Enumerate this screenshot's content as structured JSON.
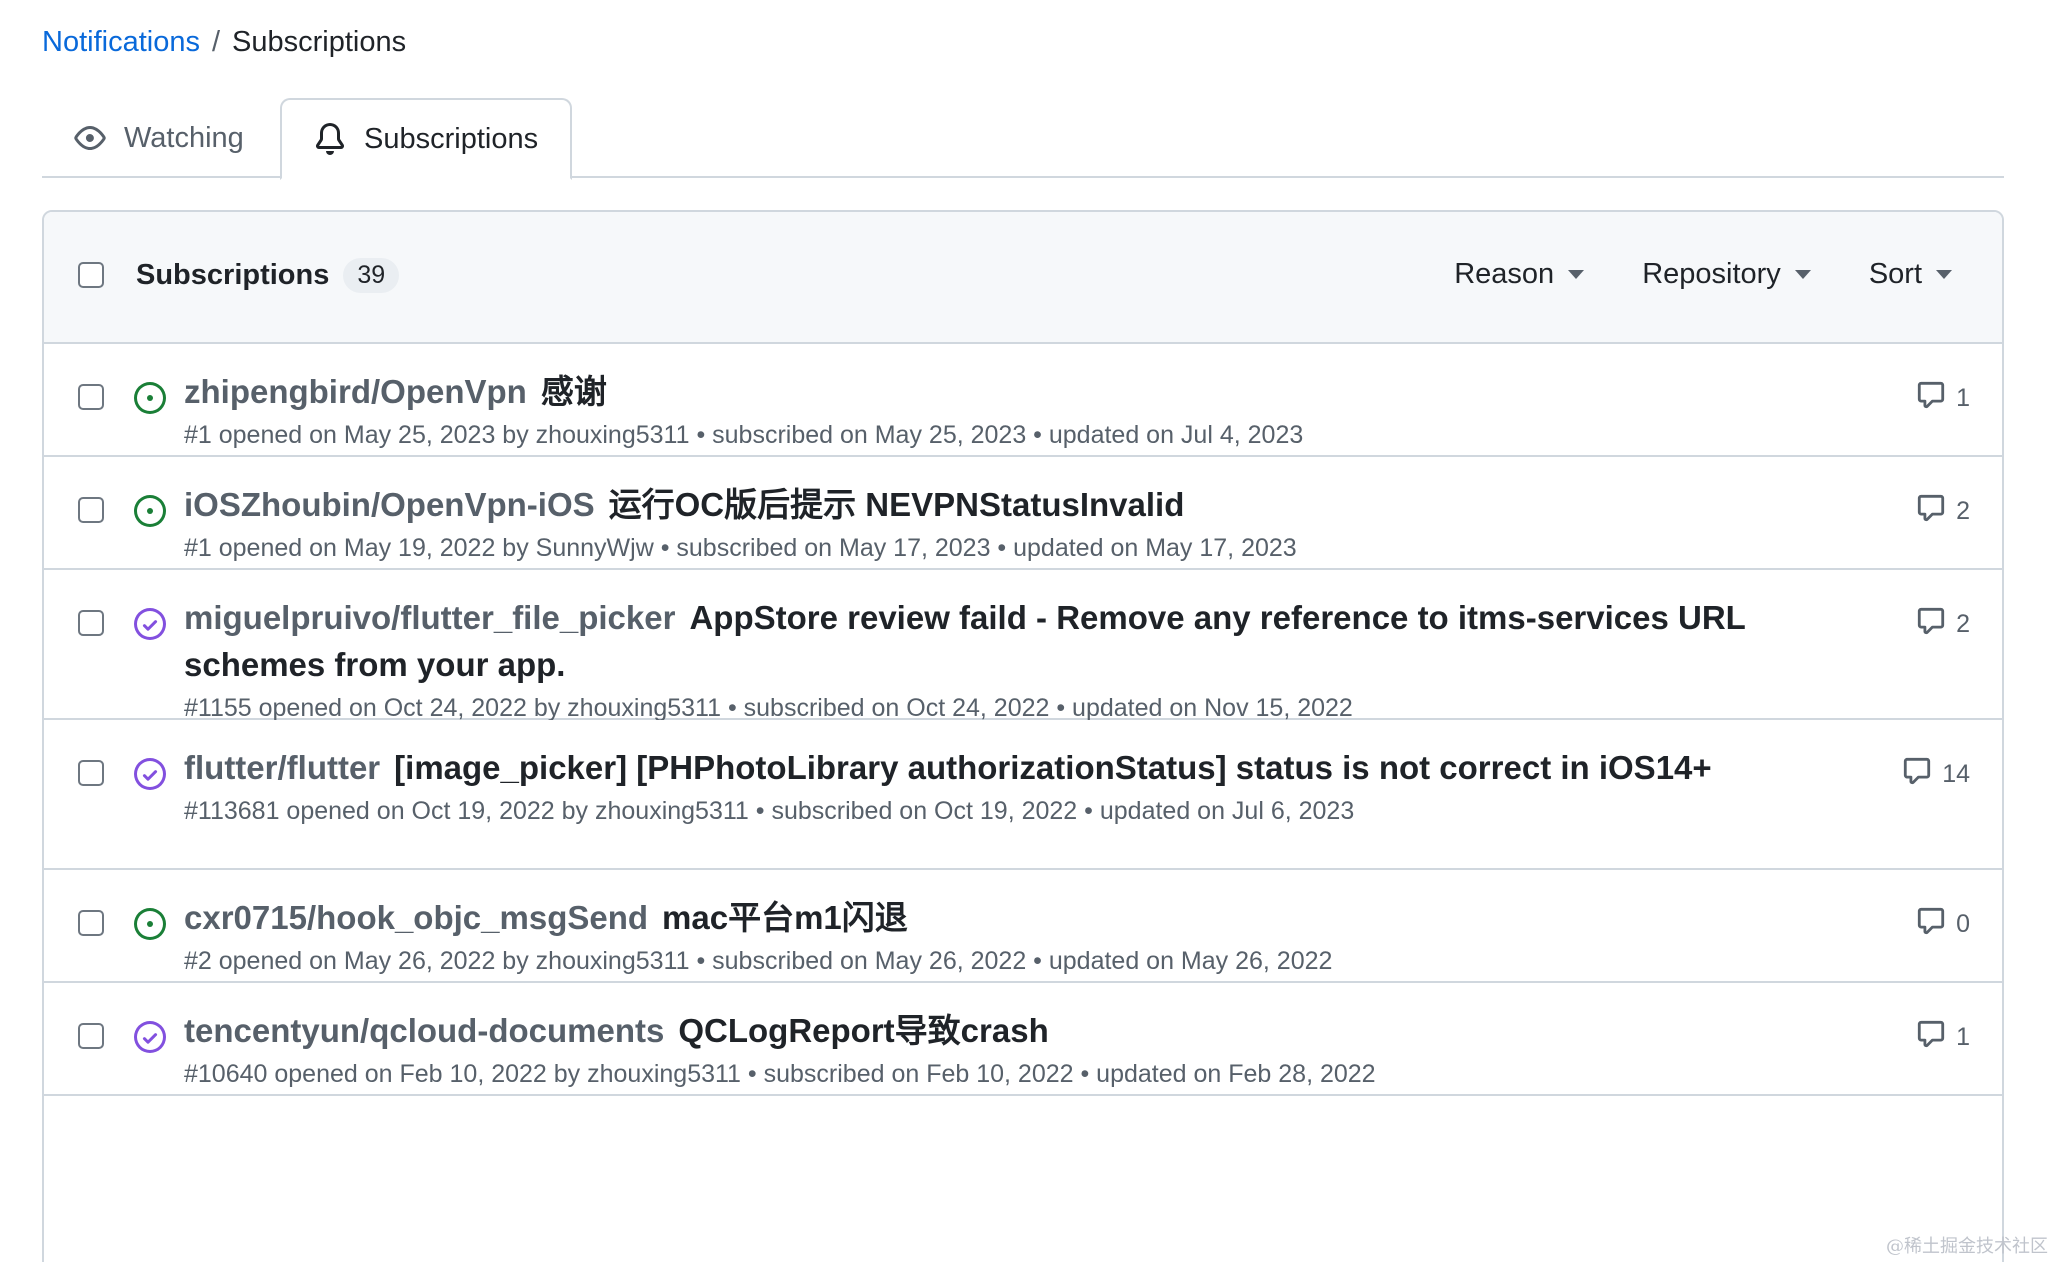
{
  "breadcrumb": {
    "parent": "Notifications",
    "separator": "/",
    "current": "Subscriptions"
  },
  "tabs": [
    {
      "label": "Watching",
      "icon": "eye-icon",
      "active": false
    },
    {
      "label": "Subscriptions",
      "icon": "bell-icon",
      "active": true
    }
  ],
  "header": {
    "title": "Subscriptions",
    "count": "39",
    "filters": [
      "Reason",
      "Repository",
      "Sort"
    ]
  },
  "colors": {
    "link": "#0969da",
    "open": "#1a7f37",
    "closed_completed": "#8250df",
    "muted": "#57606a",
    "border": "#d0d7de"
  },
  "rows": [
    {
      "repo": "zhipengbird/OpenVpn",
      "title": "感谢",
      "status": "open",
      "meta": "#1 opened on May 25, 2023 by zhouxing5311 • subscribed on May 25, 2023 • updated on Jul 4, 2023",
      "comments": "1"
    },
    {
      "repo": "iOSZhoubin/OpenVpn-iOS",
      "title": "运行OC版后提示 NEVPNStatusInvalid",
      "status": "open",
      "meta": "#1 opened on May 19, 2022 by SunnyWjw • subscribed on May 17, 2023 • updated on May 17, 2023",
      "comments": "2"
    },
    {
      "repo": "miguelpruivo/flutter_file_picker",
      "title": "AppStore review faild - Remove any reference to itms-services URL schemes from your app.",
      "status": "closed",
      "meta": "#1155 opened on Oct 24, 2022 by zhouxing5311 • subscribed on Oct 24, 2022 • updated on Nov 15, 2022",
      "comments": "2"
    },
    {
      "repo": "flutter/flutter",
      "title": "[image_picker] [PHPhotoLibrary authorizationStatus] status is not correct in iOS14+",
      "status": "closed",
      "meta": "#113681 opened on Oct 19, 2022 by zhouxing5311 • subscribed on Oct 19, 2022 • updated on Jul 6, 2023",
      "comments": "14"
    },
    {
      "repo": "cxr0715/hook_objc_msgSend",
      "title": "mac平台m1闪退",
      "status": "open",
      "meta": "#2 opened on May 26, 2022 by zhouxing5311 • subscribed on May 26, 2022 • updated on May 26, 2022",
      "comments": "0"
    },
    {
      "repo": "tencentyun/qcloud-documents",
      "title": "QCLogReport导致crash",
      "status": "closed",
      "meta": "#10640 opened on Feb 10, 2022 by zhouxing5311 • subscribed on Feb 10, 2022 • updated on Feb 28, 2022",
      "comments": "1"
    }
  ],
  "watermark": "@稀土掘金技术社区"
}
